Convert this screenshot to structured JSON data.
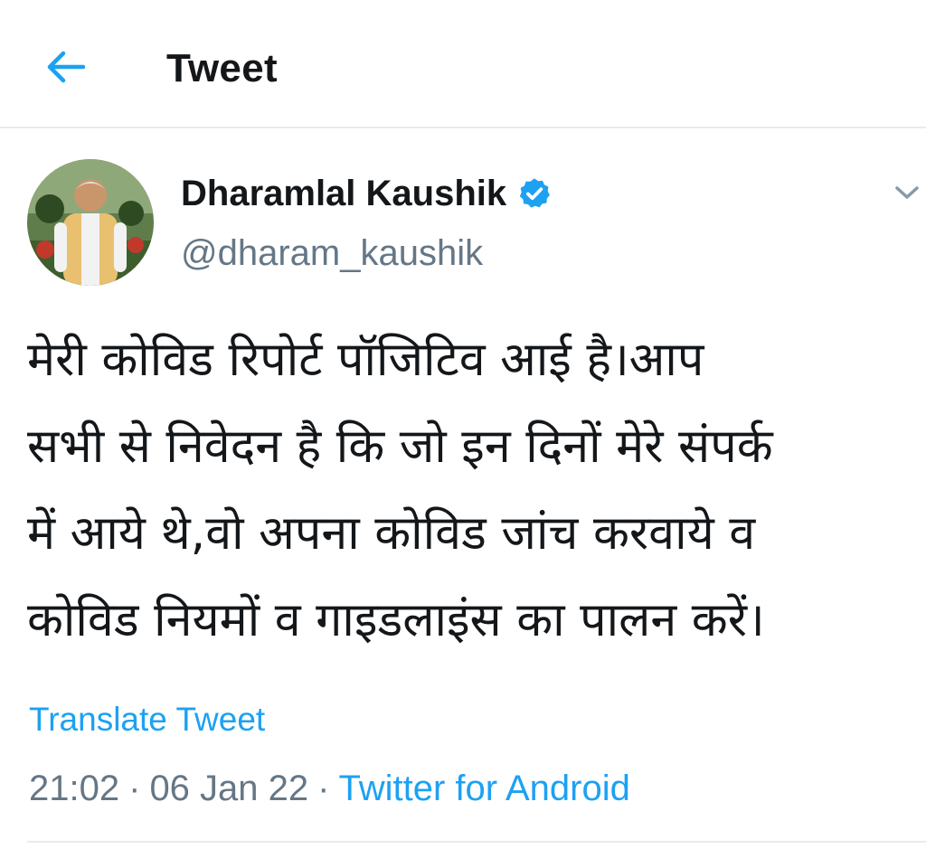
{
  "header": {
    "back_icon": "arrow-left-icon",
    "title": "Tweet"
  },
  "author": {
    "name": "Dharamlal Kaushik",
    "handle": "@dharam_kaushik",
    "verified_icon": "verified-badge-icon",
    "menu_icon": "chevron-down-icon"
  },
  "tweet": {
    "lines": [
      "मेरी कोविड रिपोर्ट पॉजिटिव आई है।आप",
      "सभी से निवेदन है कि जो इन दिनों मेरे संपर्क",
      "में आये थे,वो अपना कोविड जांच करवाये व",
      "कोविड नियमों व गाइडलाइंस का पालन करें।"
    ],
    "translate_label": "Translate Tweet",
    "time": "21:02",
    "date": "06 Jan 22",
    "separator": "·",
    "source": "Twitter for Android"
  },
  "colors": {
    "accent": "#1da1f2",
    "secondary_text": "#657786",
    "divider": "#e6ecf0"
  }
}
